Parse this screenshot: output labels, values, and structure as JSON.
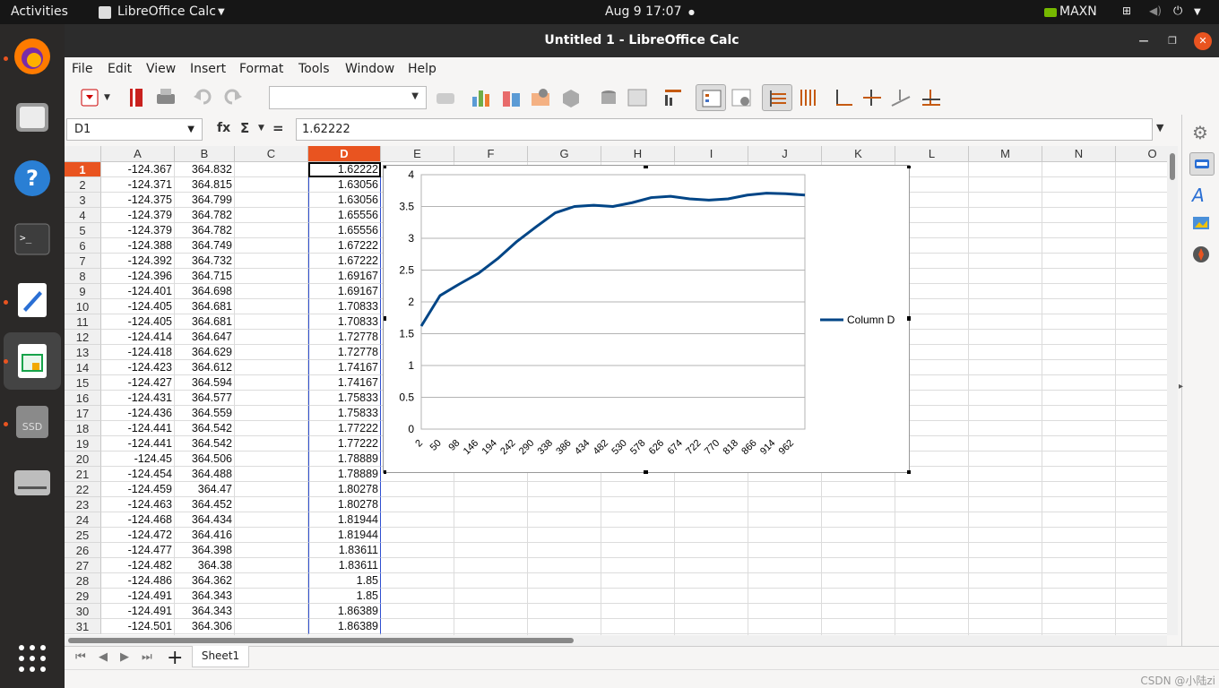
{
  "topbar": {
    "activities": "Activities",
    "app_name": "LibreOffice Calc",
    "clock": "Aug 9  17:07",
    "gpu_label": "MAXN"
  },
  "window": {
    "title": "Untitled 1 - LibreOffice Calc"
  },
  "menu": [
    "File",
    "Edit",
    "View",
    "Insert",
    "Format",
    "Tools",
    "Window",
    "Help"
  ],
  "formula": {
    "cell_ref": "D1",
    "value": "1.62222",
    "fx": "fx",
    "sum": "Σ",
    "equals": "="
  },
  "columns": [
    "A",
    "B",
    "C",
    "D",
    "E",
    "F",
    "G",
    "H",
    "I",
    "J",
    "K",
    "L",
    "M",
    "N",
    "O"
  ],
  "rows": [
    [
      "1",
      "-124.367",
      "364.832",
      "1.62222"
    ],
    [
      "2",
      "-124.371",
      "364.815",
      "1.63056"
    ],
    [
      "3",
      "-124.375",
      "364.799",
      "1.63056"
    ],
    [
      "4",
      "-124.379",
      "364.782",
      "1.65556"
    ],
    [
      "5",
      "-124.379",
      "364.782",
      "1.65556"
    ],
    [
      "6",
      "-124.388",
      "364.749",
      "1.67222"
    ],
    [
      "7",
      "-124.392",
      "364.732",
      "1.67222"
    ],
    [
      "8",
      "-124.396",
      "364.715",
      "1.69167"
    ],
    [
      "9",
      "-124.401",
      "364.698",
      "1.69167"
    ],
    [
      "10",
      "-124.405",
      "364.681",
      "1.70833"
    ],
    [
      "11",
      "-124.405",
      "364.681",
      "1.70833"
    ],
    [
      "12",
      "-124.414",
      "364.647",
      "1.72778"
    ],
    [
      "13",
      "-124.418",
      "364.629",
      "1.72778"
    ],
    [
      "14",
      "-124.423",
      "364.612",
      "1.74167"
    ],
    [
      "15",
      "-124.427",
      "364.594",
      "1.74167"
    ],
    [
      "16",
      "-124.431",
      "364.577",
      "1.75833"
    ],
    [
      "17",
      "-124.436",
      "364.559",
      "1.75833"
    ],
    [
      "18",
      "-124.441",
      "364.542",
      "1.77222"
    ],
    [
      "19",
      "-124.441",
      "364.542",
      "1.77222"
    ],
    [
      "20",
      "-124.45",
      "364.506",
      "1.78889"
    ],
    [
      "21",
      "-124.454",
      "364.488",
      "1.78889"
    ],
    [
      "22",
      "-124.459",
      "364.47",
      "1.80278"
    ],
    [
      "23",
      "-124.463",
      "364.452",
      "1.80278"
    ],
    [
      "24",
      "-124.468",
      "364.434",
      "1.81944"
    ],
    [
      "25",
      "-124.472",
      "364.416",
      "1.81944"
    ],
    [
      "26",
      "-124.477",
      "364.398",
      "1.83611"
    ],
    [
      "27",
      "-124.482",
      "364.38",
      "1.83611"
    ],
    [
      "28",
      "-124.486",
      "364.362",
      "1.85"
    ],
    [
      "29",
      "-124.491",
      "364.343",
      "1.85"
    ],
    [
      "30",
      "-124.491",
      "364.343",
      "1.86389"
    ],
    [
      "31",
      "-124.501",
      "364.306",
      "1.86389"
    ]
  ],
  "sheet": {
    "tab": "Sheet1"
  },
  "watermark": "CSDN @小陆zi",
  "chart_data": {
    "type": "line",
    "title": "",
    "xlabel": "",
    "ylabel": "",
    "ylim": [
      0,
      4
    ],
    "yticks": [
      "0",
      "0.5",
      "1",
      "1.5",
      "2",
      "2.5",
      "3",
      "3.5",
      "4"
    ],
    "xticks": [
      "2",
      "50",
      "98",
      "146",
      "194",
      "242",
      "290",
      "338",
      "386",
      "434",
      "482",
      "530",
      "578",
      "626",
      "674",
      "722",
      "770",
      "818",
      "866",
      "914",
      "962"
    ],
    "x": [
      1,
      50,
      100,
      150,
      200,
      250,
      300,
      350,
      400,
      450,
      500,
      550,
      600,
      650,
      700,
      750,
      800,
      850,
      900,
      950,
      1000
    ],
    "series": [
      {
        "name": "Column D",
        "color": "#004586",
        "values": [
          1.62,
          2.1,
          2.28,
          2.45,
          2.68,
          2.95,
          3.18,
          3.4,
          3.5,
          3.52,
          3.5,
          3.56,
          3.64,
          3.66,
          3.62,
          3.6,
          3.62,
          3.68,
          3.71,
          3.7,
          3.68
        ]
      }
    ],
    "legend": "right",
    "grid": true
  }
}
